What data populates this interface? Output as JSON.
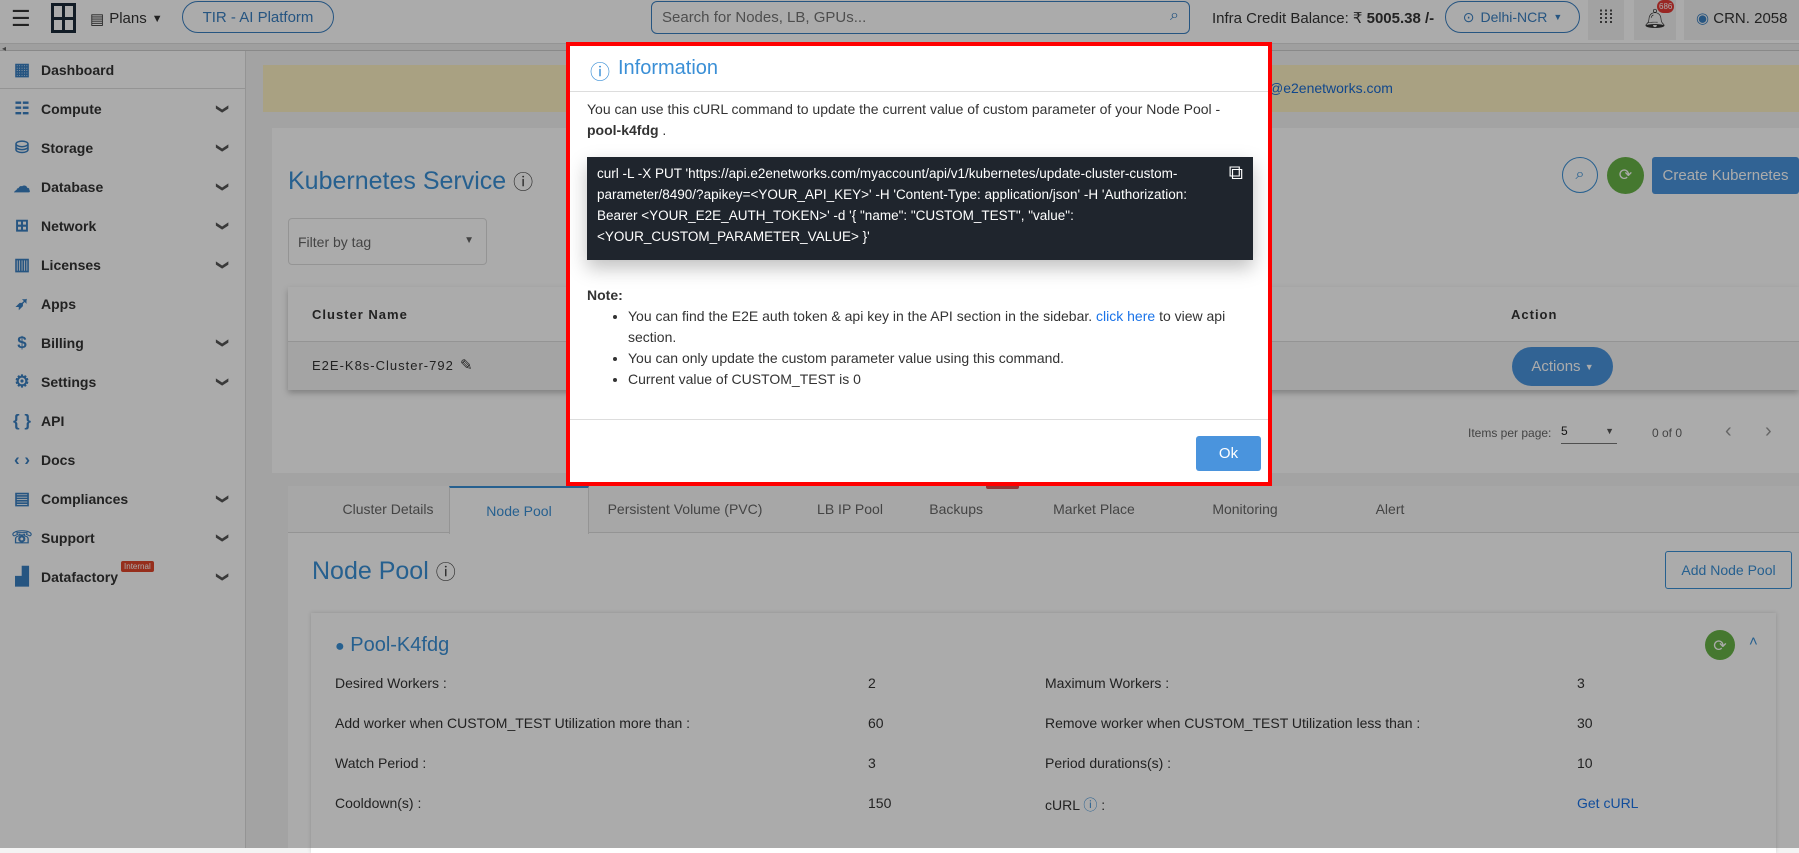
{
  "topbar": {
    "plans_label": "Plans",
    "platform_button": "TIR - AI Platform",
    "search_placeholder": "Search for Nodes, LB, GPUs...",
    "credit_label": "Infra Credit Balance: ₹",
    "credit_value": "5005.38 /-",
    "region": "Delhi-NCR",
    "notification_count": "686",
    "account": "CRN. 2058"
  },
  "sidebar": {
    "items": [
      {
        "label": "Dashboard",
        "icon": "dashboard-icon",
        "glyph": "▦",
        "chevron": false
      },
      {
        "label": "Compute",
        "icon": "server-icon",
        "glyph": "☷",
        "chevron": true
      },
      {
        "label": "Storage",
        "icon": "database-icon",
        "glyph": "⛁",
        "chevron": true
      },
      {
        "label": "Database",
        "icon": "cloud-icon",
        "glyph": "☁",
        "chevron": true
      },
      {
        "label": "Network",
        "icon": "network-icon",
        "glyph": "⊞",
        "chevron": true
      },
      {
        "label": "Licenses",
        "icon": "licenses-icon",
        "glyph": "▥",
        "chevron": true
      },
      {
        "label": "Apps",
        "icon": "rocket-icon",
        "glyph": "➶",
        "chevron": false
      },
      {
        "label": "Billing",
        "icon": "billing-icon",
        "glyph": "$",
        "chevron": true
      },
      {
        "label": "Settings",
        "icon": "gear-icon",
        "glyph": "⚙",
        "chevron": true
      },
      {
        "label": "API",
        "icon": "braces-icon",
        "glyph": "{ }",
        "chevron": false
      },
      {
        "label": "Docs",
        "icon": "code-icon",
        "glyph": "‹ ›",
        "chevron": false
      },
      {
        "label": "Compliances",
        "icon": "document-icon",
        "glyph": "▤",
        "chevron": true
      },
      {
        "label": "Support",
        "icon": "support-icon",
        "glyph": "☏",
        "chevron": true
      },
      {
        "label": "Datafactory",
        "icon": "factory-icon",
        "glyph": "▟",
        "chevron": true,
        "badge": "Internal"
      }
    ]
  },
  "banner": {
    "text": "@e2enetworks.com"
  },
  "main": {
    "title": "Kubernetes Service",
    "create_button": "Create Kubernetes",
    "filter_placeholder": "Filter by tag",
    "table": {
      "headers": [
        "Cluster Name",
        "Action"
      ],
      "rows": [
        {
          "name": "E2E-K8s-Cluster-792",
          "action": "Actions"
        }
      ]
    },
    "pagination": {
      "items_per_page_label": "Items per page:",
      "items_per_page": "5",
      "range": "0 of 0"
    },
    "tabs": [
      {
        "label": "Cluster Details"
      },
      {
        "label": "Node Pool",
        "active": true
      },
      {
        "label": "Persistent Volume (PVC)"
      },
      {
        "label": "LB IP Pool"
      },
      {
        "label": "Backups",
        "badge": "Internal"
      },
      {
        "label": "Market Place"
      },
      {
        "label": "Monitoring"
      },
      {
        "label": "Alert"
      }
    ],
    "nodepool": {
      "title": "Node Pool",
      "add_button": "Add Node Pool",
      "pool_name": "Pool-K4fdg",
      "fields": [
        {
          "label": "Desired Workers :",
          "value": "2",
          "label2": "Maximum Workers :",
          "value2": "3"
        },
        {
          "label": "Add worker when CUSTOM_TEST Utilization more than :",
          "value": "60",
          "label2": "Remove worker when CUSTOM_TEST Utilization less than :",
          "value2": "30"
        },
        {
          "label": "Watch Period :",
          "value": "3",
          "label2": "Period durations(s) :",
          "value2": "10"
        },
        {
          "label": "Cooldown(s) :",
          "value": "150",
          "label2": "cURL",
          "value2": "Get cURL"
        }
      ]
    }
  },
  "modal": {
    "title": "Information",
    "intro": "You can use this cURL command to update the current value of custom parameter of your Node Pool -",
    "pool": "pool-k4fdg",
    "intro_end": " .",
    "command": "curl -L -X PUT 'https://api.e2enetworks.com/myaccount/api/v1/kubernetes/update-cluster-custom-parameter/8490/?apikey=<YOUR_API_KEY>' -H 'Content-Type: application/json' -H 'Authorization: Bearer <YOUR_E2E_AUTH_TOKEN>' -d '{ \"name\": \"CUSTOM_TEST\", \"value\": <YOUR_CUSTOM_PARAMETER_VALUE> }'",
    "note_label": "Note:",
    "note1_a": "You can find the E2E auth token & api key in the API section in the sidebar.",
    "note1_link": "click here",
    "note1_b": "to view api section.",
    "note2": "You can only update the custom parameter value using this command.",
    "note3": "Current value of CUSTOM_TEST is 0",
    "ok": "Ok"
  },
  "colors": {
    "accent": "#3a8fd6",
    "modal_border": "#ff0000",
    "code_bg": "#1f252d",
    "refresh_green": "#67b346"
  }
}
